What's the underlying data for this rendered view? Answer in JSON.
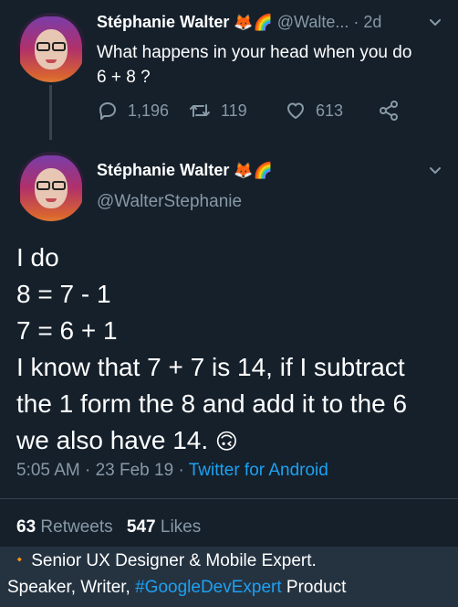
{
  "parent_tweet": {
    "display_name": "Stéphanie Walter",
    "name_emojis": "🦊🌈",
    "handle": "@Walte...",
    "separator": "·",
    "time": "2d",
    "text_line1": "What happens in your head when you do",
    "text_line2": "6 + 8 ?",
    "replies": "1,196",
    "retweets": "119",
    "likes": "613"
  },
  "reply_tweet": {
    "display_name": "Stéphanie Walter",
    "name_emojis": "🦊🌈",
    "handle": "@WalterStephanie",
    "lines": [
      "I do",
      "8 = 7 - 1",
      "7 = 6 + 1",
      "I know that 7 + 7 is 14, if I subtract",
      "the 1 form the 8 and add it to the 6",
      "we also have 14."
    ],
    "trailing_emoji": "🙃",
    "timestamp": "5:05 AM · 23 Feb 19 · ",
    "source": "Twitter for Android",
    "retweet_count": "63",
    "retweet_label": "Retweets",
    "like_count": "547",
    "like_label": "Likes"
  },
  "bio_preview": {
    "bullet": "🔸",
    "line1": "Senior UX Designer & Mobile Expert.",
    "line2_start": "Speaker, Writer, ",
    "hashtag": "#GoogleDevExpert",
    "line2_end": " Product"
  },
  "colors": {
    "background": "#15202b",
    "muted_text": "#8899a6",
    "link": "#1da1f2",
    "divider": "#38444d",
    "bottom_bar": "#253341"
  }
}
